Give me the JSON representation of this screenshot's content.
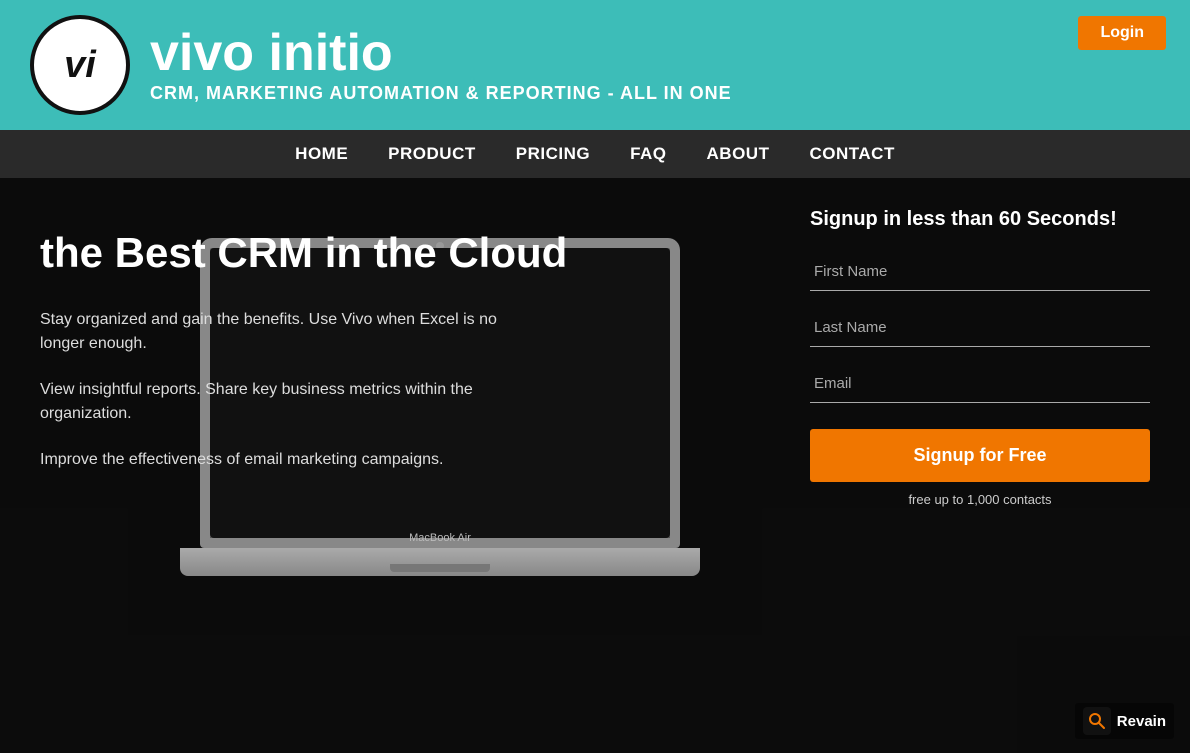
{
  "header": {
    "logo_text": "vi",
    "brand_name": "vivo initio",
    "brand_tagline": "CRM, MARKETING AUTOMATION & REPORTING - ALL IN ONE",
    "login_label": "Login"
  },
  "nav": {
    "items": [
      {
        "label": "HOME",
        "id": "home"
      },
      {
        "label": "PRODUCT",
        "id": "product"
      },
      {
        "label": "PRICING",
        "id": "pricing"
      },
      {
        "label": "FAQ",
        "id": "faq"
      },
      {
        "label": "ABOUT",
        "id": "about"
      },
      {
        "label": "CONTACT",
        "id": "contact"
      }
    ]
  },
  "hero": {
    "title": "the Best CRM in the Cloud",
    "desc1": "Stay organized and gain the benefits. Use Vivo when Excel is no longer enough.",
    "desc2": "View insightful reports. Share key business metrics within the organization.",
    "desc3": "Improve the effectiveness of email marketing campaigns."
  },
  "signup": {
    "title": "Signup in less than 60 Seconds!",
    "first_name_placeholder": "First Name",
    "last_name_placeholder": "Last Name",
    "email_placeholder": "Email",
    "button_label": "Signup for Free",
    "note": "free up to 1,000 contacts"
  },
  "laptop": {
    "label": "MacBook Air"
  },
  "watermark": {
    "icon": "🔍",
    "text": "Revain"
  }
}
